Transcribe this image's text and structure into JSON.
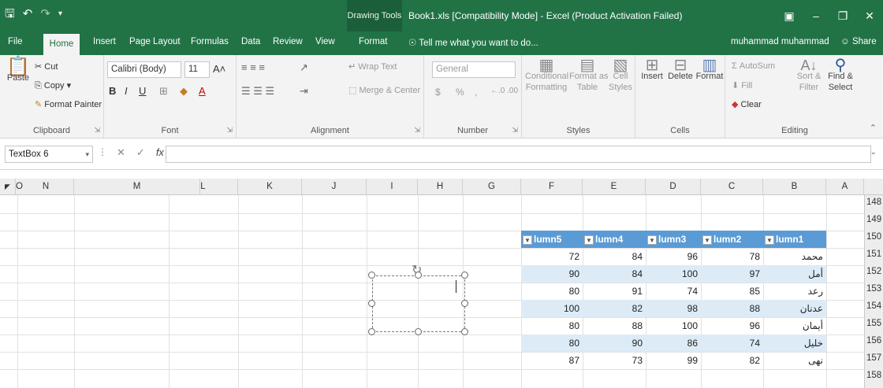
{
  "window": {
    "qat_icons": [
      "save-icon",
      "undo-icon",
      "redo-icon",
      "customize-qat-icon"
    ],
    "drawing_tools": "Drawing Tools",
    "title": "Book1.xls  [Compatibility Mode] - Excel (Product Activation Failed)",
    "controls": [
      "ribbon-display-icon",
      "minimize-icon",
      "restore-icon",
      "close-icon"
    ]
  },
  "tabs": [
    "File",
    "Home",
    "Insert",
    "Page Layout",
    "Formulas",
    "Data",
    "Review",
    "View",
    "Format"
  ],
  "tell_me": "Tell me what you want to do...",
  "user": "muhammad muhammad",
  "share": "Share",
  "ribbon": {
    "clipboard": {
      "paste": "Paste",
      "cut": "Cut",
      "copy": "Copy",
      "format_painter": "Format Painter",
      "label": "Clipboard"
    },
    "font": {
      "name": "Calibri (Body)",
      "size": "11",
      "label": "Font",
      "bold": "B",
      "italic": "I",
      "underline": "U"
    },
    "alignment": {
      "wrap": "Wrap Text",
      "merge": "Merge & Center",
      "label": "Alignment"
    },
    "number": {
      "format": "General",
      "currency": "$",
      "percent": "%",
      "comma": ",",
      "label": "Number"
    },
    "styles": {
      "conditional": "Conditional",
      "conditional2": "Formatting",
      "format_as": "Format as",
      "format_as2": "Table",
      "cell": "Cell",
      "cell2": "Styles",
      "label": "Styles"
    },
    "cells": {
      "insert": "Insert",
      "delete": "Delete",
      "format": "Format",
      "label": "Cells"
    },
    "editing": {
      "autosum": "AutoSum",
      "fill": "Fill",
      "clear": "Clear",
      "sort": "Sort &",
      "sort2": "Filter",
      "find": "Find &",
      "find2": "Select",
      "label": "Editing"
    }
  },
  "formula_bar": {
    "name_box": "TextBox 6",
    "value": ""
  },
  "columns": [
    "O",
    "N",
    "M",
    "L",
    "K",
    "J",
    "I",
    "H",
    "G",
    "F",
    "E",
    "D",
    "C",
    "B",
    "A"
  ],
  "rows": [
    "148",
    "149",
    "150",
    "151",
    "152",
    "153",
    "154",
    "155",
    "156",
    "157",
    "158"
  ],
  "table": {
    "headers": [
      "lumn5",
      "lumn4",
      "lumn3",
      "lumn2",
      "lumn1"
    ],
    "rows": [
      [
        "72",
        "84",
        "96",
        "78",
        "محمد"
      ],
      [
        "90",
        "84",
        "100",
        "97",
        "أمل"
      ],
      [
        "80",
        "91",
        "74",
        "85",
        "رعد"
      ],
      [
        "100",
        "82",
        "98",
        "88",
        "عدنان"
      ],
      [
        "80",
        "88",
        "100",
        "96",
        "أيمان"
      ],
      [
        "80",
        "90",
        "86",
        "74",
        "خليل"
      ],
      [
        "87",
        "73",
        "99",
        "82",
        "نهى"
      ]
    ]
  },
  "textbox": {
    "text": ""
  }
}
